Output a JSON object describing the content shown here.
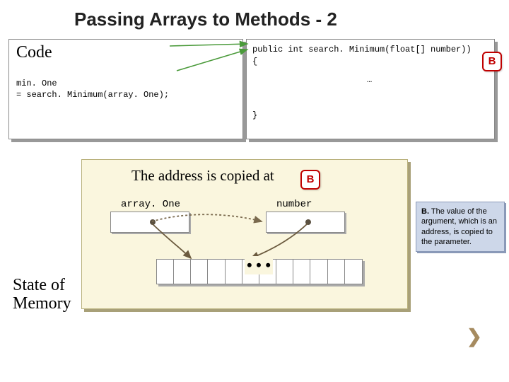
{
  "title": "Passing Arrays to Methods - 2",
  "code_panel": {
    "label": "Code",
    "line1": "min. One",
    "line2": "= search. Minimum(array. One);"
  },
  "method_panel": {
    "signature": "public int search. Minimum(float[] number))",
    "open_brace": "{",
    "body": "…",
    "close_brace": "}"
  },
  "badge": "B",
  "memory_panel": {
    "address_text": "The address is copied at",
    "var1": "array. One",
    "var2": "number",
    "array_ellipsis": "• • •"
  },
  "state_label_l1": "State of",
  "state_label_l2": "Memory",
  "explain": {
    "prefix": "B.",
    "text": " The value of the argument, which is an address, is copied to the parameter."
  },
  "chevron": "❯"
}
